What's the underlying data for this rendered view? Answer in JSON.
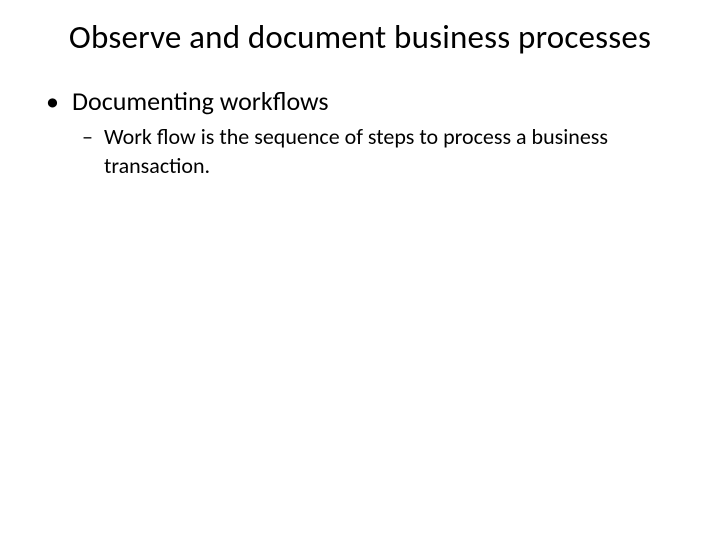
{
  "slide": {
    "title": "Observe and document business processes",
    "bullets": [
      {
        "marker": "•",
        "text": "Documenting workflows",
        "children": [
          {
            "marker": "–",
            "text": "Work flow is the sequence of steps to process a business transaction."
          }
        ]
      }
    ]
  }
}
